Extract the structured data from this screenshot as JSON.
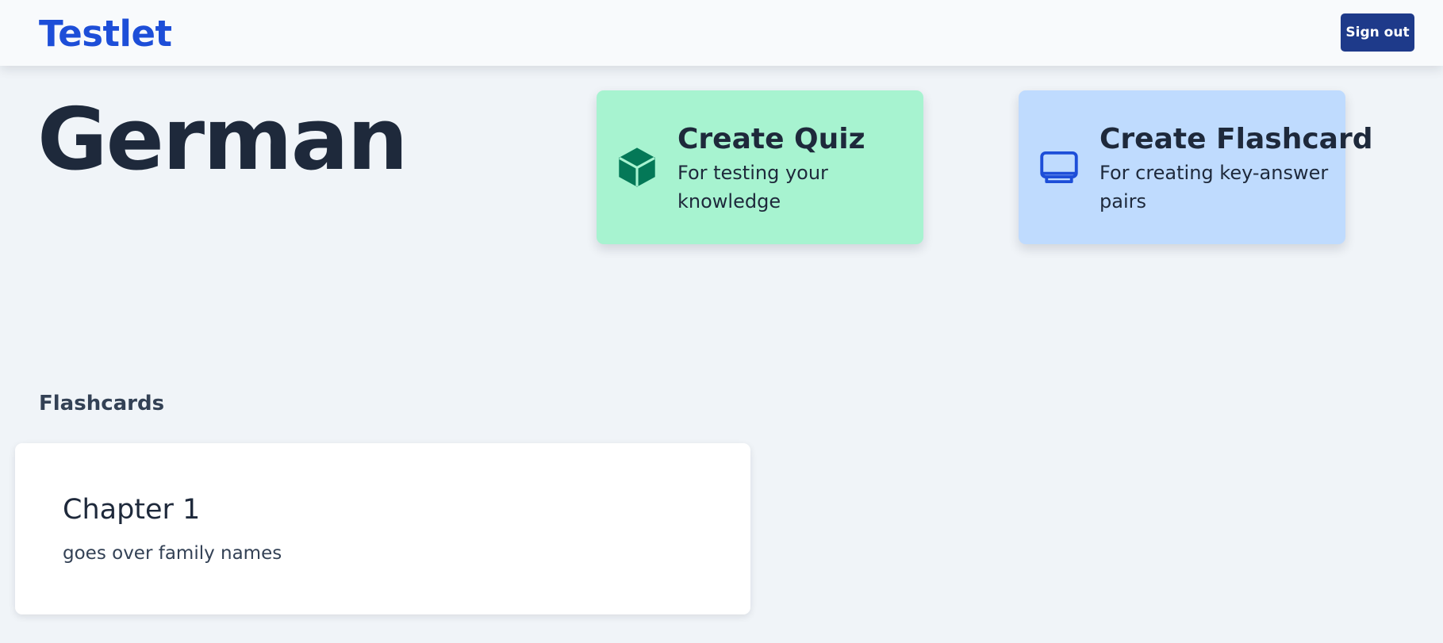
{
  "header": {
    "brand": "Testlet",
    "signout_label": "Sign out"
  },
  "page": {
    "title": "German"
  },
  "actions": {
    "quiz": {
      "title": "Create Quiz",
      "description": "For testing your knowledge",
      "icon": "cube-icon",
      "color": "#a7f3d0",
      "icon_color": "#047857"
    },
    "flashcard": {
      "title": "Create Flashcard",
      "description": "For creating key-answer pairs",
      "icon": "device-tablet-icon",
      "color": "#bfdbfe",
      "icon_color": "#1d4ed8"
    }
  },
  "flashcards": {
    "heading": "Flashcards",
    "items": [
      {
        "title": "Chapter 1",
        "description": "goes over family names"
      }
    ]
  },
  "colors": {
    "brand": "#1d4ed8",
    "signout_button": "#1e3a8a",
    "background": "#f0f4f8",
    "navbar": "#f8fafc"
  }
}
